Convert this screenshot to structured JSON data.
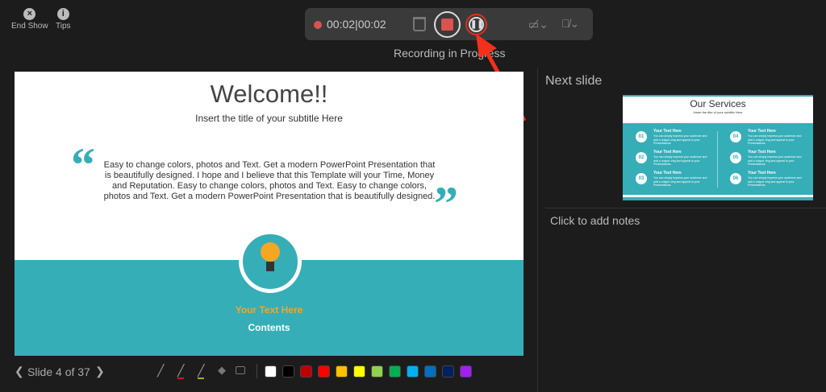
{
  "top": {
    "end_show": "End Show",
    "tips": "Tips"
  },
  "recorder": {
    "elapsed": "00:02",
    "total": "00:02",
    "separator": "|",
    "status": "Recording in Progress"
  },
  "slide": {
    "title": "Welcome!!",
    "subtitle": "Insert the title of your subtitle Here",
    "body": "Easy to change colors, photos and Text. Get a modern PowerPoint  Presentation that is beautifully designed. I hope and I believe that this Template will your Time, Money and Reputation. Easy to change colors, photos and Text. Easy to change colors, photos and Text. Get a modern PowerPoint  Presentation that is beautifully designed.",
    "highlight": "Your Text  Here",
    "contents": "Contents",
    "accent": "#35aeb8",
    "highlight_color": "#f5a623"
  },
  "next": {
    "label": "Next slide",
    "title": "Our Services",
    "subtitle": "Insert the title of your subtitle Here",
    "items": [
      {
        "num": "01",
        "head": "Your Text  Here",
        "text": "You can simply impress your audience and add a unique zing and appeal to your Presentations."
      },
      {
        "num": "02",
        "head": "Your Text  Here",
        "text": "You can simply impress your audience and add a unique zing and appeal to your Presentations."
      },
      {
        "num": "03",
        "head": "Your Text  Here",
        "text": "You can simply impress your audience and add a unique zing and appeal to your Presentations."
      },
      {
        "num": "04",
        "head": "Your Text  Here",
        "text": "You can simply impress your audience and add a unique zing and appeal to your Presentations."
      },
      {
        "num": "05",
        "head": "Your Text  Here",
        "text": "You can simply impress your audience and add a unique zing and appeal to your Presentations."
      },
      {
        "num": "06",
        "head": "Your Text  Here",
        "text": "You can simply impress your audience and add a unique zing and appeal to your Presentations."
      }
    ]
  },
  "notes": {
    "placeholder": "Click to add notes"
  },
  "nav": {
    "slide_label": "Slide 4 of 37"
  },
  "colors": [
    "#ffffff",
    "#000000",
    "#c00000",
    "#ff0000",
    "#ffc000",
    "#ffff00",
    "#92d050",
    "#00b050",
    "#00b0f0",
    "#0070c0",
    "#002060",
    "#a020f0"
  ]
}
